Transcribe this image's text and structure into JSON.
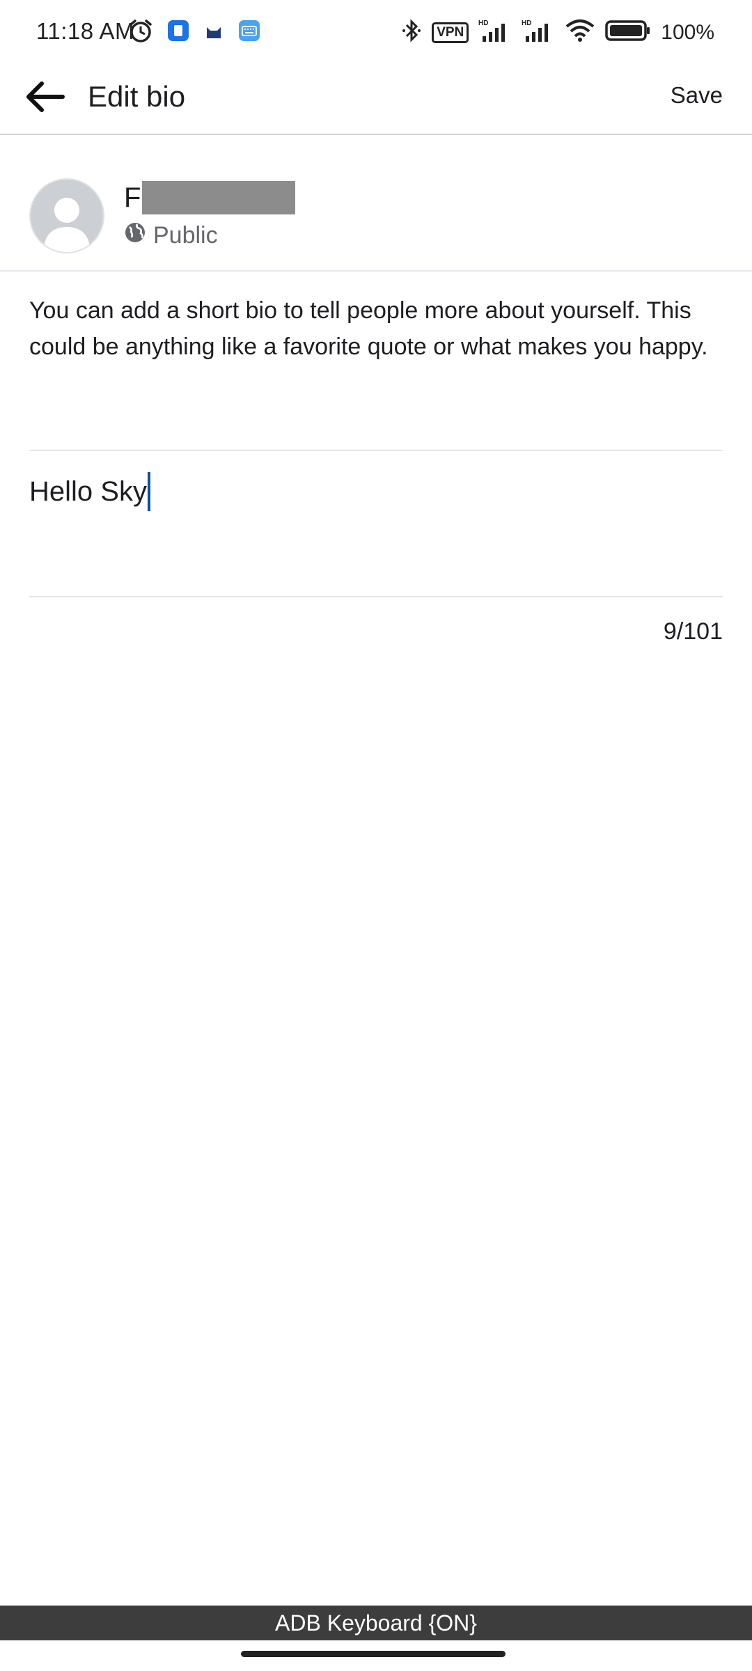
{
  "status_bar": {
    "time": "11:18 AM",
    "vpn_label": "VPN",
    "battery_text": "100%",
    "left_icons": [
      "alarm-icon",
      "app-notification-icon",
      "cat-app-icon",
      "keyboard-app-icon"
    ],
    "right_icons": [
      "bluetooth-icon",
      "vpn-icon",
      "signal-hd-icon",
      "signal-hd-icon",
      "wifi-icon",
      "battery-icon"
    ]
  },
  "header": {
    "title": "Edit bio",
    "save_label": "Save",
    "back_icon": "arrow-left-icon"
  },
  "profile": {
    "name_initial": "F",
    "audience": "Public",
    "audience_icon": "globe-icon"
  },
  "description": "You can add a short bio to tell people more about yourself. This could be anything like a favorite quote or what makes you happy.",
  "bio_input": {
    "value": "Hello Sky",
    "char_count": "9/101"
  },
  "footer": {
    "adb_label": "ADB Keyboard {ON}"
  },
  "colors": {
    "caret": "#0a4fa8",
    "secondary_text": "#65676b",
    "adb_bar": "#3d3d3d"
  }
}
